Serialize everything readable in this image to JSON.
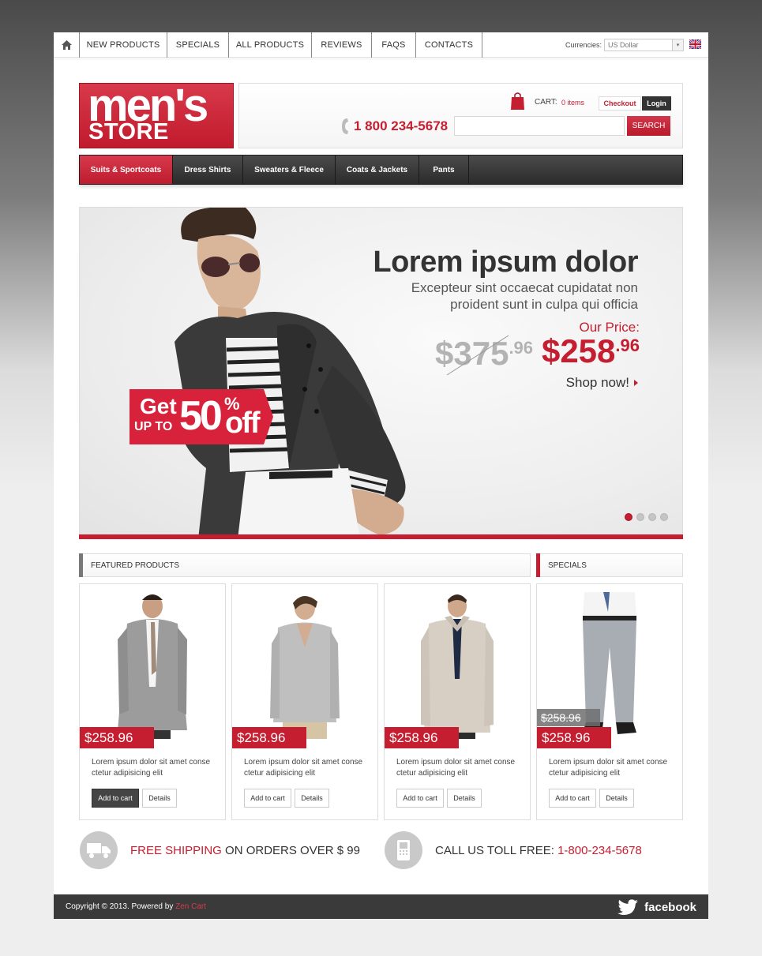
{
  "topnav": {
    "items": [
      "NEW PRODUCTS",
      "SPECIALS",
      "ALL PRODUCTS",
      "REVIEWS",
      "FAQS",
      "CONTACTS"
    ],
    "currency_label": "Currencies:",
    "currency_value": "US Dollar"
  },
  "logo": {
    "line1": "men's",
    "line2": "STORE"
  },
  "header": {
    "cart_label": "CART:",
    "cart_count": "0 items",
    "checkout_label": "Checkout",
    "login_label": "Login",
    "phone": "1 800 234-5678",
    "search_placeholder": "",
    "search_label": "SEARCH"
  },
  "categories": [
    {
      "label": "Suits & Sportcoats",
      "active": true
    },
    {
      "label": "Dress Shirts",
      "active": false
    },
    {
      "label": "Sweaters & Fleece",
      "active": false
    },
    {
      "label": "Coats & Jackets",
      "active": false
    },
    {
      "label": "Pants",
      "active": false
    }
  ],
  "banner": {
    "title": "Lorem ipsum dolor",
    "subtitle": "Excepteur sint occaecat cupidatat non proident sunt in culpa qui officia",
    "our_price_label": "Our Price:",
    "old_price_main": "$375",
    "old_price_cents": ".96",
    "new_price_main": "$258",
    "new_price_cents": ".96",
    "shop_label": "Shop now!",
    "promo_get": "Get",
    "promo_upto": "UP TO",
    "promo_number": "50",
    "promo_percent": "%",
    "promo_off": "off",
    "slides": 4,
    "active_slide": 1
  },
  "sections": {
    "featured": "FEATURED PRODUCTS",
    "specials": "SPECIALS"
  },
  "products": [
    {
      "price": "$258.96",
      "desc": "Lorem ipsum dolor sit amet conse ctetur adipisicing elit",
      "add": "Add to cart",
      "details": "Details"
    },
    {
      "price": "$258.96",
      "desc": "Lorem ipsum dolor sit amet conse ctetur adipisicing elit",
      "add": "Add to cart",
      "details": "Details"
    },
    {
      "price": "$258.96",
      "desc": "Lorem ipsum dolor sit amet conse ctetur adipisicing elit",
      "add": "Add to cart",
      "details": "Details"
    },
    {
      "price": "$258.96",
      "old_price": "$258.96",
      "desc": "Lorem ipsum dolor sit amet conse ctetur adipisicing elit",
      "add": "Add to cart",
      "details": "Details"
    }
  ],
  "info": {
    "shipping_highlight": "FREE SHIPPING",
    "shipping_rest": "ON ORDERS OVER $ 99",
    "call_label": "CALL US TOLL FREE:",
    "call_number": "1-800-234-5678"
  },
  "footer": {
    "copyright": "Copyright © 2013. Powered by",
    "powered": "Zen Cart",
    "facebook": "facebook"
  },
  "colors": {
    "accent": "#c41e30",
    "dark": "#333333"
  }
}
